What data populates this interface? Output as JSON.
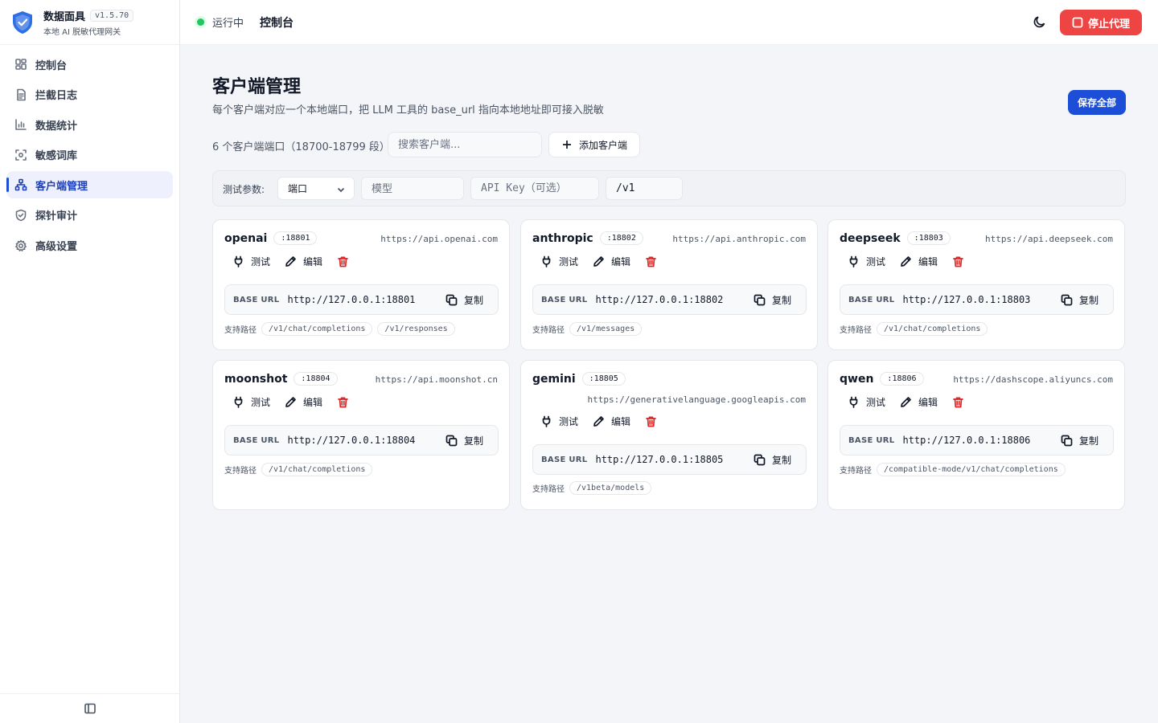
{
  "app": {
    "name": "数据面具",
    "version": "v1.5.70",
    "subtitle": "本地 AI 脱敏代理网关"
  },
  "sidebar": {
    "items": [
      {
        "label": "控制台",
        "icon": "dashboard-icon"
      },
      {
        "label": "拦截日志",
        "icon": "file-text-icon"
      },
      {
        "label": "数据统计",
        "icon": "bar-chart-icon"
      },
      {
        "label": "敏感词库",
        "icon": "scan-icon"
      },
      {
        "label": "客户端管理",
        "icon": "network-icon",
        "active": true
      },
      {
        "label": "探针审计",
        "icon": "shield-check-icon"
      },
      {
        "label": "高级设置",
        "icon": "gear-icon"
      }
    ]
  },
  "topbar": {
    "status": "运行中",
    "title": "控制台",
    "stop_label": "停止代理"
  },
  "page": {
    "title": "客户端管理",
    "description": "每个客户端对应一个本地端口，把 LLM 工具的 base_url 指向本地地址即可接入脱敏",
    "save_all": "保存全部",
    "count_text": "6 个客户端端口（18700-18799 段）",
    "search_placeholder": "搜索客户端...",
    "add_label": "添加客户端"
  },
  "test_params": {
    "label": "测试参数:",
    "port_select": "端口",
    "model_placeholder": "模型",
    "key_placeholder": "API Key（可选）",
    "path_value": "/v1"
  },
  "labels": {
    "test": "测试",
    "edit": "编辑",
    "base_url": "BASE URL",
    "copy": "复制",
    "paths": "支持路径"
  },
  "clients": [
    {
      "name": "openai",
      "port": ":18801",
      "upstream": "https://api.openai.com",
      "base_url": "http://127.0.0.1:18801",
      "paths": [
        "/v1/chat/completions",
        "/v1/responses"
      ]
    },
    {
      "name": "anthropic",
      "port": ":18802",
      "upstream": "https://api.anthropic.com",
      "base_url": "http://127.0.0.1:18802",
      "paths": [
        "/v1/messages"
      ]
    },
    {
      "name": "deepseek",
      "port": ":18803",
      "upstream": "https://api.deepseek.com",
      "base_url": "http://127.0.0.1:18803",
      "paths": [
        "/v1/chat/completions"
      ]
    },
    {
      "name": "moonshot",
      "port": ":18804",
      "upstream": "https://api.moonshot.cn",
      "base_url": "http://127.0.0.1:18804",
      "paths": [
        "/v1/chat/completions"
      ]
    },
    {
      "name": "gemini",
      "port": ":18805",
      "upstream": "https://generativelanguage.googleapis.com",
      "base_url": "http://127.0.0.1:18805",
      "paths": [
        "/v1beta/models"
      ]
    },
    {
      "name": "qwen",
      "port": ":18806",
      "upstream": "https://dashscope.aliyuncs.com",
      "base_url": "http://127.0.0.1:18806",
      "paths": [
        "/compatible-mode/v1/chat/completions"
      ]
    }
  ]
}
